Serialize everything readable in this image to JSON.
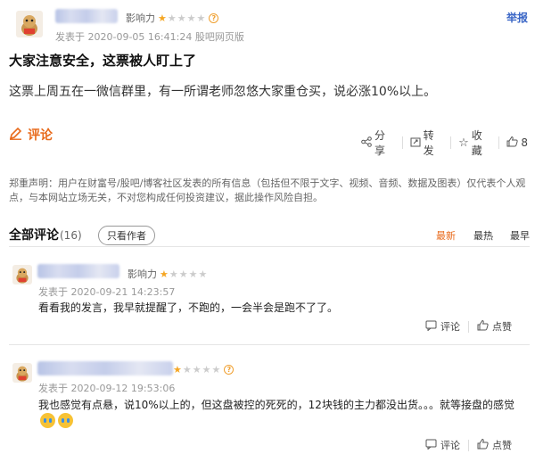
{
  "post": {
    "influence_label": "影响力",
    "stars_on": 1,
    "stars_total": 5,
    "help_glyph": "?",
    "meta": "发表于 2020-09-05 16:41:24 股吧网页版",
    "report_label": "举报",
    "title": "大家注意安全，这票被人盯上了",
    "body": "这票上周五在一微信群里，有一所谓老师忽悠大家重仓买，说必涨10%以上。",
    "comment_label": "评论",
    "actions": {
      "share": "分享",
      "repost": "转发",
      "favorite": "收藏",
      "like_count": "8"
    },
    "disclaimer": "郑重声明：用户在财富号/股吧/博客社区发表的所有信息（包括但不限于文字、视频、音频、数据及图表）仅代表个人观点，与本网站立场无关，不对您构成任何投资建议，据此操作风险自担。"
  },
  "comments_header": {
    "title": "全部评论",
    "count": "(16)",
    "author_only": "只看作者",
    "sort": [
      "最新",
      "最热",
      "最早"
    ]
  },
  "comments": [
    {
      "influence_label": "影响力",
      "stars_on": 1,
      "meta": "发表于 2020-09-21 14:23:57",
      "text": "看看我的发言，我早就提醒了，不跑的，一会半会是跑不了了。",
      "reply_label": "评论",
      "like_label": "点赞"
    },
    {
      "stars_on": 1,
      "meta": "发表于 2020-09-12 19:53:06",
      "text": "我也感觉有点悬，说10%以上的，但这盘被控的死死的，12块钱的主力都没出货。。。就等接盘的感觉",
      "reply_label": "评论",
      "like_label": "点赞"
    }
  ]
}
